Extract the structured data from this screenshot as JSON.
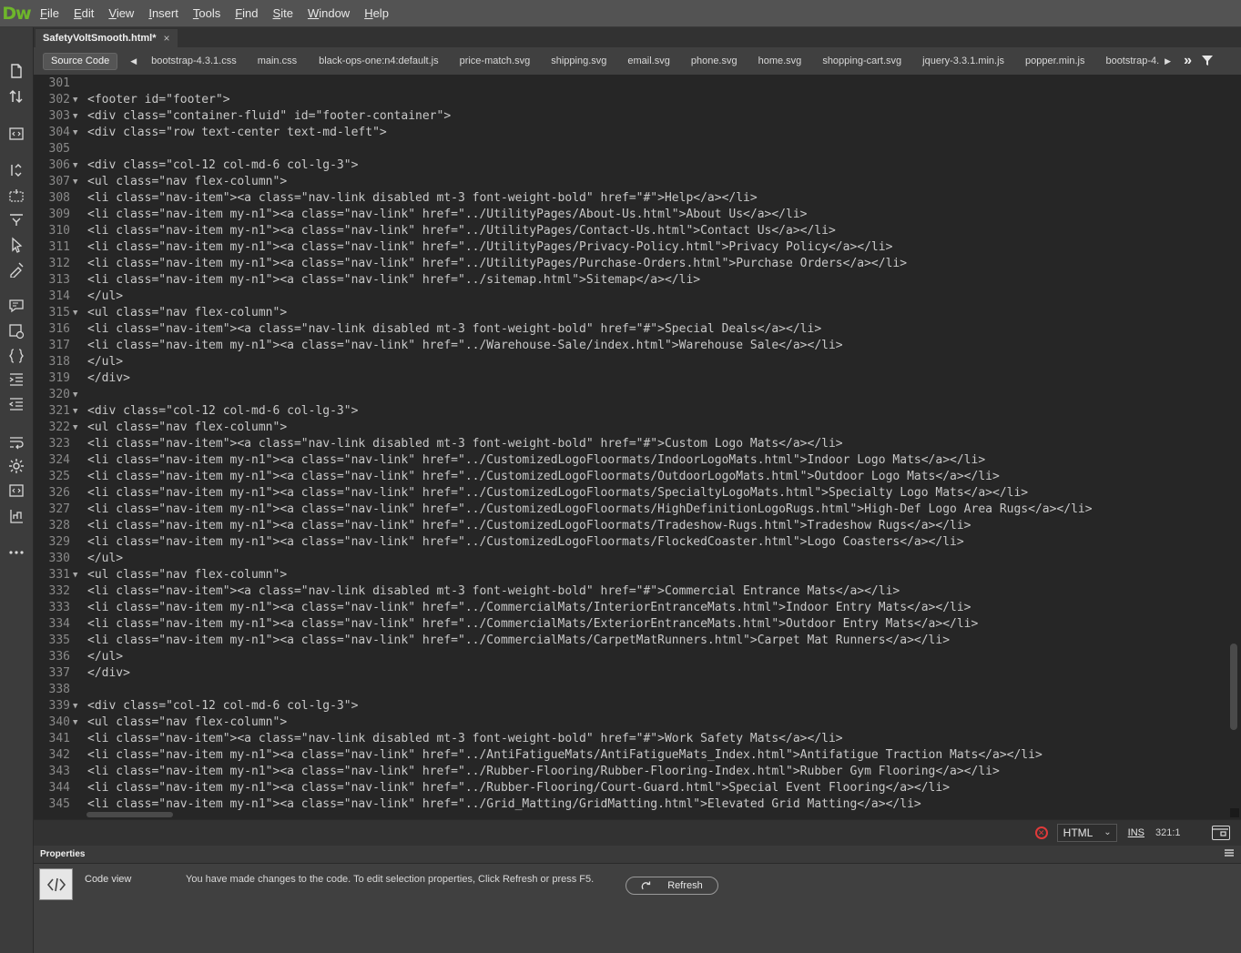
{
  "app": {
    "logo": "Dw"
  },
  "menu": [
    "File",
    "Edit",
    "View",
    "Insert",
    "Tools",
    "Find",
    "Site",
    "Window",
    "Help"
  ],
  "document": {
    "tab_title": "SafetyVoltSmooth.html*",
    "close_glyph": "×"
  },
  "related_files": {
    "source_label": "Source Code",
    "files": [
      "bootstrap-4.3.1.css",
      "main.css",
      "black-ops-one:n4:default.js",
      "price-match.svg",
      "shipping.svg",
      "email.svg",
      "phone.svg",
      "home.svg",
      "shopping-cart.svg",
      "jquery-3.3.1.min.js",
      "popper.min.js",
      "bootstrap-4."
    ],
    "more_glyph": "»"
  },
  "code_lines": [
    {
      "n": "301",
      "fold": "",
      "text": "",
      "highlight": true
    },
    {
      "n": "302",
      "fold": "▼",
      "text": "<footer id=\"footer\">"
    },
    {
      "n": "303",
      "fold": "▼",
      "text": "<div class=\"container-fluid\" id=\"footer-container\">"
    },
    {
      "n": "304",
      "fold": "▼",
      "text": "<div class=\"row text-center text-md-left\">"
    },
    {
      "n": "305",
      "fold": "",
      "text": ""
    },
    {
      "n": "306",
      "fold": "▼",
      "text": "<div class=\"col-12 col-md-6 col-lg-3\">"
    },
    {
      "n": "307",
      "fold": "▼",
      "text": "<ul class=\"nav flex-column\">"
    },
    {
      "n": "308",
      "fold": "",
      "text": "<li class=\"nav-item\"><a class=\"nav-link disabled mt-3 font-weight-bold\" href=\"#\">Help</a></li>"
    },
    {
      "n": "309",
      "fold": "",
      "text": "<li class=\"nav-item my-n1\"><a class=\"nav-link\" href=\"../UtilityPages/About-Us.html\">About Us</a></li>"
    },
    {
      "n": "310",
      "fold": "",
      "text": "<li class=\"nav-item my-n1\"><a class=\"nav-link\" href=\"../UtilityPages/Contact-Us.html\">Contact Us</a></li>"
    },
    {
      "n": "311",
      "fold": "",
      "text": "<li class=\"nav-item my-n1\"><a class=\"nav-link\" href=\"../UtilityPages/Privacy-Policy.html\">Privacy Policy</a></li>"
    },
    {
      "n": "312",
      "fold": "",
      "text": "<li class=\"nav-item my-n1\"><a class=\"nav-link\" href=\"../UtilityPages/Purchase-Orders.html\">Purchase Orders</a></li>"
    },
    {
      "n": "313",
      "fold": "",
      "text": "<li class=\"nav-item my-n1\"><a class=\"nav-link\" href=\"../sitemap.html\">Sitemap</a></li>"
    },
    {
      "n": "314",
      "fold": "",
      "text": "</ul>"
    },
    {
      "n": "315",
      "fold": "▼",
      "text": "<ul class=\"nav flex-column\">"
    },
    {
      "n": "316",
      "fold": "",
      "text": "<li class=\"nav-item\"><a class=\"nav-link disabled mt-3 font-weight-bold\" href=\"#\">Special Deals</a></li>"
    },
    {
      "n": "317",
      "fold": "",
      "text": "<li class=\"nav-item my-n1\"><a class=\"nav-link\" href=\"../Warehouse-Sale/index.html\">Warehouse Sale</a></li>"
    },
    {
      "n": "318",
      "fold": "",
      "text": "</ul>"
    },
    {
      "n": "319",
      "fold": "",
      "text": "</div>"
    },
    {
      "n": "320",
      "fold": "▼",
      "text": "",
      "highlight": true
    },
    {
      "n": "321",
      "fold": "▼",
      "text": "<div class=\"col-12 col-md-6 col-lg-3\">"
    },
    {
      "n": "322",
      "fold": "▼",
      "text": "<ul class=\"nav flex-column\">"
    },
    {
      "n": "323",
      "fold": "",
      "text": "<li class=\"nav-item\"><a class=\"nav-link disabled mt-3 font-weight-bold\" href=\"#\">Custom Logo Mats</a></li>"
    },
    {
      "n": "324",
      "fold": "",
      "text": "<li class=\"nav-item my-n1\"><a class=\"nav-link\" href=\"../CustomizedLogoFloormats/IndoorLogoMats.html\">Indoor Logo Mats</a></li>"
    },
    {
      "n": "325",
      "fold": "",
      "text": "<li class=\"nav-item my-n1\"><a class=\"nav-link\" href=\"../CustomizedLogoFloormats/OutdoorLogoMats.html\">Outdoor Logo Mats</a></li>"
    },
    {
      "n": "326",
      "fold": "",
      "text": "<li class=\"nav-item my-n1\"><a class=\"nav-link\" href=\"../CustomizedLogoFloormats/SpecialtyLogoMats.html\">Specialty Logo Mats</a></li>"
    },
    {
      "n": "327",
      "fold": "",
      "text": "<li class=\"nav-item my-n1\"><a class=\"nav-link\" href=\"../CustomizedLogoFloormats/HighDefinitionLogoRugs.html\">High-Def Logo Area Rugs</a></li>"
    },
    {
      "n": "328",
      "fold": "",
      "text": "<li class=\"nav-item my-n1\"><a class=\"nav-link\" href=\"../CustomizedLogoFloormats/Tradeshow-Rugs.html\">Tradeshow Rugs</a></li>"
    },
    {
      "n": "329",
      "fold": "",
      "text": "<li class=\"nav-item my-n1\"><a class=\"nav-link\" href=\"../CustomizedLogoFloormats/FlockedCoaster.html\">Logo Coasters</a></li>"
    },
    {
      "n": "330",
      "fold": "",
      "text": "</ul>"
    },
    {
      "n": "331",
      "fold": "▼",
      "text": "<ul class=\"nav flex-column\">"
    },
    {
      "n": "332",
      "fold": "",
      "text": "<li class=\"nav-item\"><a class=\"nav-link disabled mt-3 font-weight-bold\" href=\"#\">Commercial Entrance Mats</a></li>"
    },
    {
      "n": "333",
      "fold": "",
      "text": "<li class=\"nav-item my-n1\"><a class=\"nav-link\" href=\"../CommercialMats/InteriorEntranceMats.html\">Indoor Entry Mats</a></li>"
    },
    {
      "n": "334",
      "fold": "",
      "text": "<li class=\"nav-item my-n1\"><a class=\"nav-link\" href=\"../CommercialMats/ExteriorEntranceMats.html\">Outdoor Entry Mats</a></li>"
    },
    {
      "n": "335",
      "fold": "",
      "text": "<li class=\"nav-item my-n1\"><a class=\"nav-link\" href=\"../CommercialMats/CarpetMatRunners.html\">Carpet Mat Runners</a></li>"
    },
    {
      "n": "336",
      "fold": "",
      "text": "</ul>"
    },
    {
      "n": "337",
      "fold": "",
      "text": "</div>"
    },
    {
      "n": "338",
      "fold": "",
      "text": ""
    },
    {
      "n": "339",
      "fold": "▼",
      "text": "<div class=\"col-12 col-md-6 col-lg-3\">"
    },
    {
      "n": "340",
      "fold": "▼",
      "text": "<ul class=\"nav flex-column\">"
    },
    {
      "n": "341",
      "fold": "",
      "text": "<li class=\"nav-item\"><a class=\"nav-link disabled mt-3 font-weight-bold\" href=\"#\">Work Safety Mats</a></li>"
    },
    {
      "n": "342",
      "fold": "",
      "text": "<li class=\"nav-item my-n1\"><a class=\"nav-link\" href=\"../AntiFatigueMats/AntiFatigueMats_Index.html\">Antifatigue Traction Mats</a></li>"
    },
    {
      "n": "343",
      "fold": "",
      "text": "<li class=\"nav-item my-n1\"><a class=\"nav-link\" href=\"../Rubber-Flooring/Rubber-Flooring-Index.html\">Rubber Gym Flooring</a></li>"
    },
    {
      "n": "344",
      "fold": "",
      "text": "<li class=\"nav-item my-n1\"><a class=\"nav-link\" href=\"../Rubber-Flooring/Court-Guard.html\">Special Event Flooring</a></li>"
    },
    {
      "n": "345",
      "fold": "",
      "text": "<li class=\"nav-item my-n1\"><a class=\"nav-link\" href=\"../Grid_Matting/GridMatting.html\">Elevated Grid Matting</a></li>"
    }
  ],
  "status": {
    "error_glyph": "✕",
    "language": "HTML",
    "insert_mode": "INS",
    "cursor": "321:1"
  },
  "properties": {
    "title": "Properties",
    "view_label": "Code view",
    "message": "You have made changes to the code. To edit selection properties, Click Refresh or press F5.",
    "refresh_label": "Refresh"
  },
  "colors": {
    "highlight": "#0a5ea0",
    "editor_bg": "#262626",
    "logo": "#6eb62b"
  },
  "icons": [
    "new-document-icon",
    "file-transfer-icon",
    "code-view-icon",
    "expand-tag-icon",
    "select-parent-icon",
    "collapse-icon",
    "select-icon",
    "format-icon",
    "comment-icon",
    "snippet-icon",
    "braces-icon",
    "indent-icon",
    "outdent-icon",
    "wrap-icon",
    "settings-icon",
    "live-code-icon",
    "hierarchy-icon",
    "more-icon"
  ]
}
